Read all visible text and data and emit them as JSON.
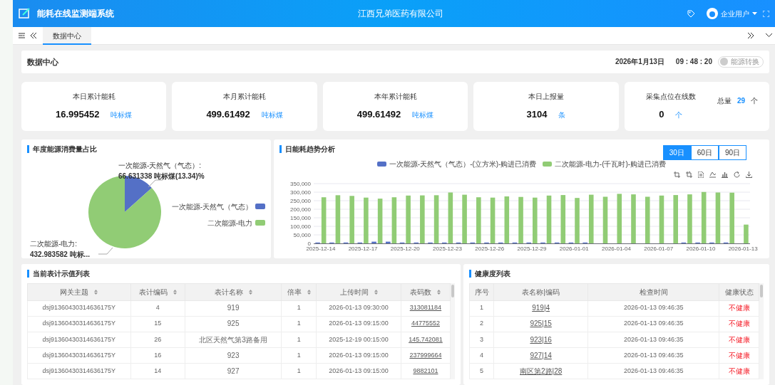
{
  "header": {
    "title": "能耗在线监测端系统",
    "company": "江西兄弟医药有限公司",
    "user": "企业用户"
  },
  "tabs": [
    {
      "label": "数据中心",
      "selected": true
    }
  ],
  "page": {
    "title": "数据中心",
    "date": "2026年1月13日",
    "time": "09 : 48 : 20",
    "toggle": {
      "label": "能源转换",
      "on": false
    }
  },
  "kpis": [
    {
      "label": "本日累计能耗",
      "value": "16.995452",
      "unit": "吨标煤"
    },
    {
      "label": "本月累计能耗",
      "value": "499.61492",
      "unit": "吨标煤"
    },
    {
      "label": "本年累计能耗",
      "value": "499.61492",
      "unit": "吨标煤"
    },
    {
      "label": "本日上报量",
      "value": "3104",
      "unit": "条"
    },
    {
      "label": "采集点位在线数",
      "value": "0",
      "unit": "个",
      "total_label": "总量",
      "total_value": "29",
      "total_unit": "个"
    }
  ],
  "pie_panel": {
    "title": "年度能源消费量占比",
    "callouts": [
      {
        "name": "一次能源-天然气（气态）:",
        "value": "66.631338 吨标煤(13.34)%"
      },
      {
        "name": "二次能源-电力:",
        "value": "432.983582 吨标..."
      }
    ],
    "chart_data": {
      "type": "pie",
      "categories": [
        "一次能源-天然气（气态）",
        "二次能源-电力"
      ],
      "values": [
        13.34,
        86.66
      ],
      "colors": [
        "#5470c6",
        "#91cc75"
      ]
    }
  },
  "trend_panel": {
    "title": "日能耗趋势分析",
    "ranges": [
      {
        "label": "30日",
        "selected": true
      },
      {
        "label": "60日",
        "selected": false
      },
      {
        "label": "90日",
        "selected": false
      }
    ],
    "chart_data": {
      "type": "bar",
      "categories": [
        "2025-12-14",
        null,
        null,
        "2025-12-17",
        null,
        null,
        "2025-12-20",
        null,
        null,
        "2025-12-23",
        null,
        null,
        "2025-12-26",
        null,
        null,
        "2025-12-29",
        null,
        null,
        "2026-01-01",
        null,
        null,
        "2026-01-04",
        null,
        null,
        "2026-01-07",
        null,
        null,
        "2026-01-10",
        null,
        null,
        "2026-01-13"
      ],
      "series": [
        {
          "name": "一次能源-天然气（气态）-(立方米)-购进已消费",
          "color": "#5470c6",
          "values": [
            5000,
            5000,
            5000,
            5000,
            10000,
            10000,
            5000,
            5000,
            5000,
            5000,
            5000,
            5000,
            5000,
            5000,
            5000,
            5000,
            5000,
            5000,
            5000,
            5000,
            0,
            0,
            0,
            0,
            0,
            0,
            5000,
            5000,
            5000,
            5000,
            0
          ]
        },
        {
          "name": "二次能源-电力-(千瓦时)-购进已消费",
          "color": "#91cc75",
          "values": [
            270000,
            282000,
            278000,
            268000,
            262000,
            270000,
            280000,
            281000,
            282000,
            298000,
            285000,
            270000,
            268000,
            275000,
            272000,
            268000,
            280000,
            283000,
            266000,
            285000,
            273000,
            290000,
            287000,
            273000,
            280000,
            283000,
            287000,
            301000,
            298000,
            297000,
            110000
          ]
        }
      ],
      "ylim": [
        0,
        350000
      ],
      "yticks": [
        0,
        {
          "value": 50000,
          "label": "50,000"
        },
        {
          "value": 100000,
          "label": "100,000"
        },
        {
          "value": 150000,
          "label": "150,000"
        },
        {
          "value": 200000,
          "label": "200,000"
        },
        {
          "value": 250000,
          "label": "250,000"
        },
        {
          "value": 300000,
          "label": "300,000"
        },
        {
          "value": 350000,
          "label": "350,000"
        }
      ],
      "grid": true
    }
  },
  "meter_table": {
    "title": "当前表计示值列表",
    "columns": [
      "网关主题",
      "表计编码",
      "表计名称",
      "倍率",
      "上传时间",
      "表码数"
    ],
    "rows": [
      [
        "dsj91360430314636175Y",
        "4",
        "919",
        "1",
        "2026-01-13 09:30:00",
        "313081184"
      ],
      [
        "dsj91360430314636175Y",
        "15",
        "925",
        "1",
        "2026-01-13 09:15:00",
        "44775552"
      ],
      [
        "dsj91360430314636175Y",
        "26",
        "北区天然气第3路备用",
        "1",
        "2025-12-19 00:15:00",
        "145.742081"
      ],
      [
        "dsj91360430314636175Y",
        "16",
        "923",
        "1",
        "2026-01-13 09:15:00",
        "237999664"
      ],
      [
        "dsj91360430314636175Y",
        "14",
        "927",
        "1",
        "2026-01-13 09:15:00",
        "9882101"
      ]
    ]
  },
  "health_table": {
    "title": "健康度列表",
    "columns": [
      "序号",
      "表名称|编码",
      "检查时间",
      "健康状态"
    ],
    "rows": [
      {
        "index": "1",
        "meter": "919|4",
        "time": "2026-01-13 09:46:35",
        "status": "不健康",
        "healthy": false
      },
      {
        "index": "2",
        "meter": "925|15",
        "time": "2026-01-13 09:46:35",
        "status": "不健康",
        "healthy": false
      },
      {
        "index": "3",
        "meter": "923|16",
        "time": "2026-01-13 09:46:35",
        "status": "不健康",
        "healthy": false
      },
      {
        "index": "4",
        "meter": "927|14",
        "time": "2026-01-13 09:46:35",
        "status": "不健康",
        "healthy": false
      },
      {
        "index": "5",
        "meter": "南区第2路|28",
        "time": "2026-01-13 09:46:35",
        "status": "不健康",
        "healthy": false
      }
    ]
  }
}
